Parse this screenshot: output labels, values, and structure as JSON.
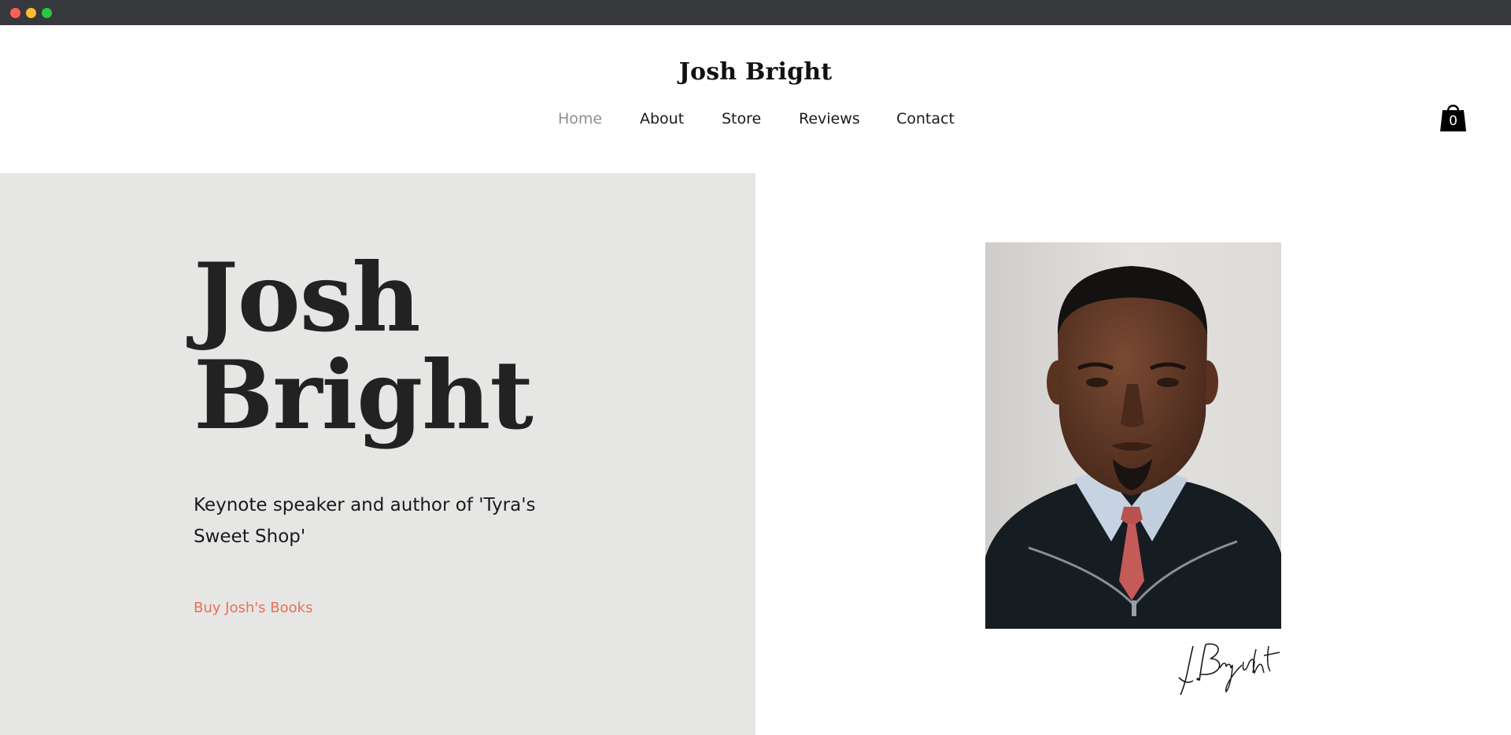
{
  "window": {
    "controls": [
      "close",
      "minimize",
      "maximize"
    ]
  },
  "header": {
    "site_title": "Josh Bright",
    "nav": [
      {
        "label": "Home",
        "active": true
      },
      {
        "label": "About",
        "active": false
      },
      {
        "label": "Store",
        "active": false
      },
      {
        "label": "Reviews",
        "active": false
      },
      {
        "label": "Contact",
        "active": false
      }
    ],
    "cart": {
      "icon": "shopping-bag-icon",
      "count": "0"
    }
  },
  "hero": {
    "name_line1": "Josh",
    "name_line2": "Bright",
    "tagline": "Keynote speaker and author of 'Tyra's Sweet Shop'",
    "cta_label": "Buy Josh's Books",
    "signature_text": "J. Bright"
  },
  "colors": {
    "hero_background": "#e6e7e5",
    "cta_accent": "#e86f55",
    "nav_active": "#8f8f8f",
    "titlebar": "#37383b"
  }
}
